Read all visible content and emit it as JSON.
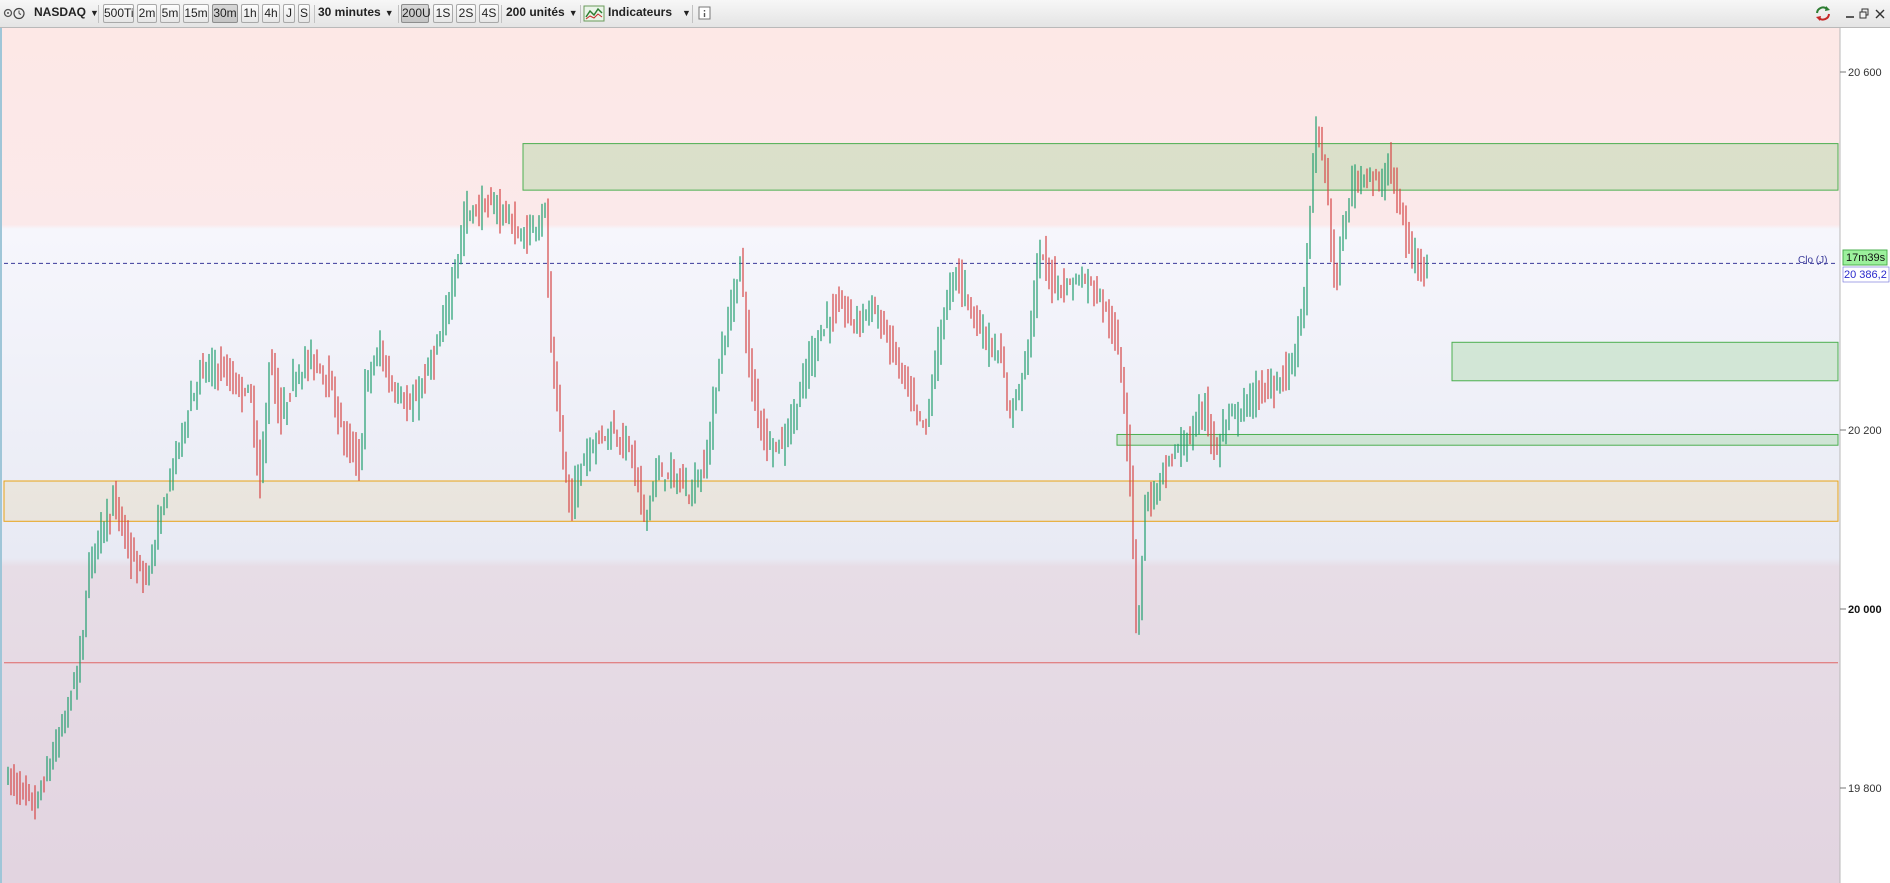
{
  "toolbar": {
    "instrument": "NASDAQ",
    "timeframe_buttons": [
      {
        "label": "500Ti",
        "active": false
      },
      {
        "label": "2m",
        "active": false
      },
      {
        "label": "5m",
        "active": false
      },
      {
        "label": "15m",
        "active": false
      },
      {
        "label": "30m",
        "active": true
      },
      {
        "label": "1h",
        "active": false
      },
      {
        "label": "4h",
        "active": false
      },
      {
        "label": "J",
        "active": false
      },
      {
        "label": "S",
        "active": false
      }
    ],
    "period_select": "30 minutes",
    "unit_buttons": [
      {
        "label": "200U",
        "active": true
      },
      {
        "label": "1S",
        "active": false
      },
      {
        "label": "2S",
        "active": false
      },
      {
        "label": "4S",
        "active": false
      }
    ],
    "units_select": "200 unités",
    "indicators_label": "Indicateurs"
  },
  "chart": {
    "price_labels": [
      {
        "text": "20 600",
        "bold": false
      },
      {
        "text": "20 200",
        "bold": false
      },
      {
        "text": "20 000",
        "bold": true
      },
      {
        "text": "19 800",
        "bold": false
      }
    ],
    "close_line_label": "Clo (J)",
    "close_price": "20 386,2",
    "close_price_value": 20386.2,
    "timer": "17m39s",
    "colors": {
      "up": "#1f9e6e",
      "down": "#d64545",
      "zone_green": "#4caf50",
      "zone_orange": "#e8a317",
      "close_line": "#3a3a9a",
      "red_line": "#e06666"
    }
  },
  "chart_data": {
    "type": "candlestick",
    "instrument": "NASDAQ",
    "timeframe": "30m",
    "y_ticks": [
      19800,
      20000,
      20200,
      20600
    ],
    "y_range": [
      19770,
      20650
    ],
    "last_close": 20386.2,
    "zones": [
      {
        "color": "green",
        "low": 20468,
        "high": 20520
      },
      {
        "color": "green",
        "low": 20255,
        "high": 20298
      },
      {
        "color": "green",
        "low": 20183,
        "high": 20195
      },
      {
        "color": "orange",
        "low": 20098,
        "high": 20143
      }
    ],
    "horizontal_lines": [
      {
        "color": "red",
        "value": 19940
      },
      {
        "color": "navy-dashed",
        "value": 20386.2
      }
    ],
    "path": [
      [
        0,
        19815
      ],
      [
        30,
        19780
      ],
      [
        55,
        19860
      ],
      [
        75,
        19945
      ],
      [
        85,
        20060
      ],
      [
        100,
        20100
      ],
      [
        110,
        20120
      ],
      [
        125,
        20060
      ],
      [
        140,
        20030
      ],
      [
        155,
        20100
      ],
      [
        170,
        20170
      ],
      [
        185,
        20230
      ],
      [
        195,
        20265
      ],
      [
        215,
        20270
      ],
      [
        230,
        20250
      ],
      [
        245,
        20240
      ],
      [
        255,
        20140
      ],
      [
        265,
        20280
      ],
      [
        275,
        20210
      ],
      [
        290,
        20260
      ],
      [
        305,
        20280
      ],
      [
        320,
        20265
      ],
      [
        340,
        20190
      ],
      [
        355,
        20160
      ],
      [
        360,
        20250
      ],
      [
        375,
        20290
      ],
      [
        385,
        20250
      ],
      [
        395,
        20240
      ],
      [
        405,
        20220
      ],
      [
        420,
        20260
      ],
      [
        435,
        20300
      ],
      [
        450,
        20380
      ],
      [
        460,
        20440
      ],
      [
        480,
        20450
      ],
      [
        500,
        20445
      ],
      [
        515,
        20410
      ],
      [
        530,
        20430
      ],
      [
        540,
        20445
      ],
      [
        545,
        20300
      ],
      [
        555,
        20200
      ],
      [
        565,
        20110
      ],
      [
        575,
        20160
      ],
      [
        590,
        20190
      ],
      [
        605,
        20200
      ],
      [
        625,
        20180
      ],
      [
        640,
        20100
      ],
      [
        650,
        20150
      ],
      [
        665,
        20150
      ],
      [
        685,
        20130
      ],
      [
        700,
        20160
      ],
      [
        715,
        20280
      ],
      [
        725,
        20330
      ],
      [
        735,
        20390
      ],
      [
        745,
        20260
      ],
      [
        760,
        20190
      ],
      [
        775,
        20180
      ],
      [
        790,
        20220
      ],
      [
        805,
        20280
      ],
      [
        820,
        20320
      ],
      [
        835,
        20340
      ],
      [
        850,
        20320
      ],
      [
        865,
        20340
      ],
      [
        880,
        20310
      ],
      [
        895,
        20270
      ],
      [
        910,
        20220
      ],
      [
        920,
        20200
      ],
      [
        935,
        20310
      ],
      [
        950,
        20380
      ],
      [
        965,
        20340
      ],
      [
        980,
        20300
      ],
      [
        995,
        20280
      ],
      [
        1005,
        20220
      ],
      [
        1015,
        20250
      ],
      [
        1025,
        20310
      ],
      [
        1035,
        20400
      ],
      [
        1045,
        20370
      ],
      [
        1060,
        20360
      ],
      [
        1075,
        20370
      ],
      [
        1090,
        20360
      ],
      [
        1105,
        20320
      ],
      [
        1115,
        20280
      ],
      [
        1125,
        20150
      ],
      [
        1132,
        19960
      ],
      [
        1140,
        20120
      ],
      [
        1150,
        20130
      ],
      [
        1165,
        20170
      ],
      [
        1185,
        20190
      ],
      [
        1200,
        20230
      ],
      [
        1210,
        20170
      ],
      [
        1220,
        20210
      ],
      [
        1235,
        20220
      ],
      [
        1250,
        20240
      ],
      [
        1270,
        20250
      ],
      [
        1285,
        20270
      ],
      [
        1300,
        20350
      ],
      [
        1310,
        20540
      ],
      [
        1320,
        20490
      ],
      [
        1330,
        20360
      ],
      [
        1345,
        20470
      ],
      [
        1360,
        20490
      ],
      [
        1375,
        20470
      ],
      [
        1385,
        20500
      ],
      [
        1395,
        20440
      ],
      [
        1405,
        20400
      ],
      [
        1420,
        20386
      ]
    ]
  }
}
